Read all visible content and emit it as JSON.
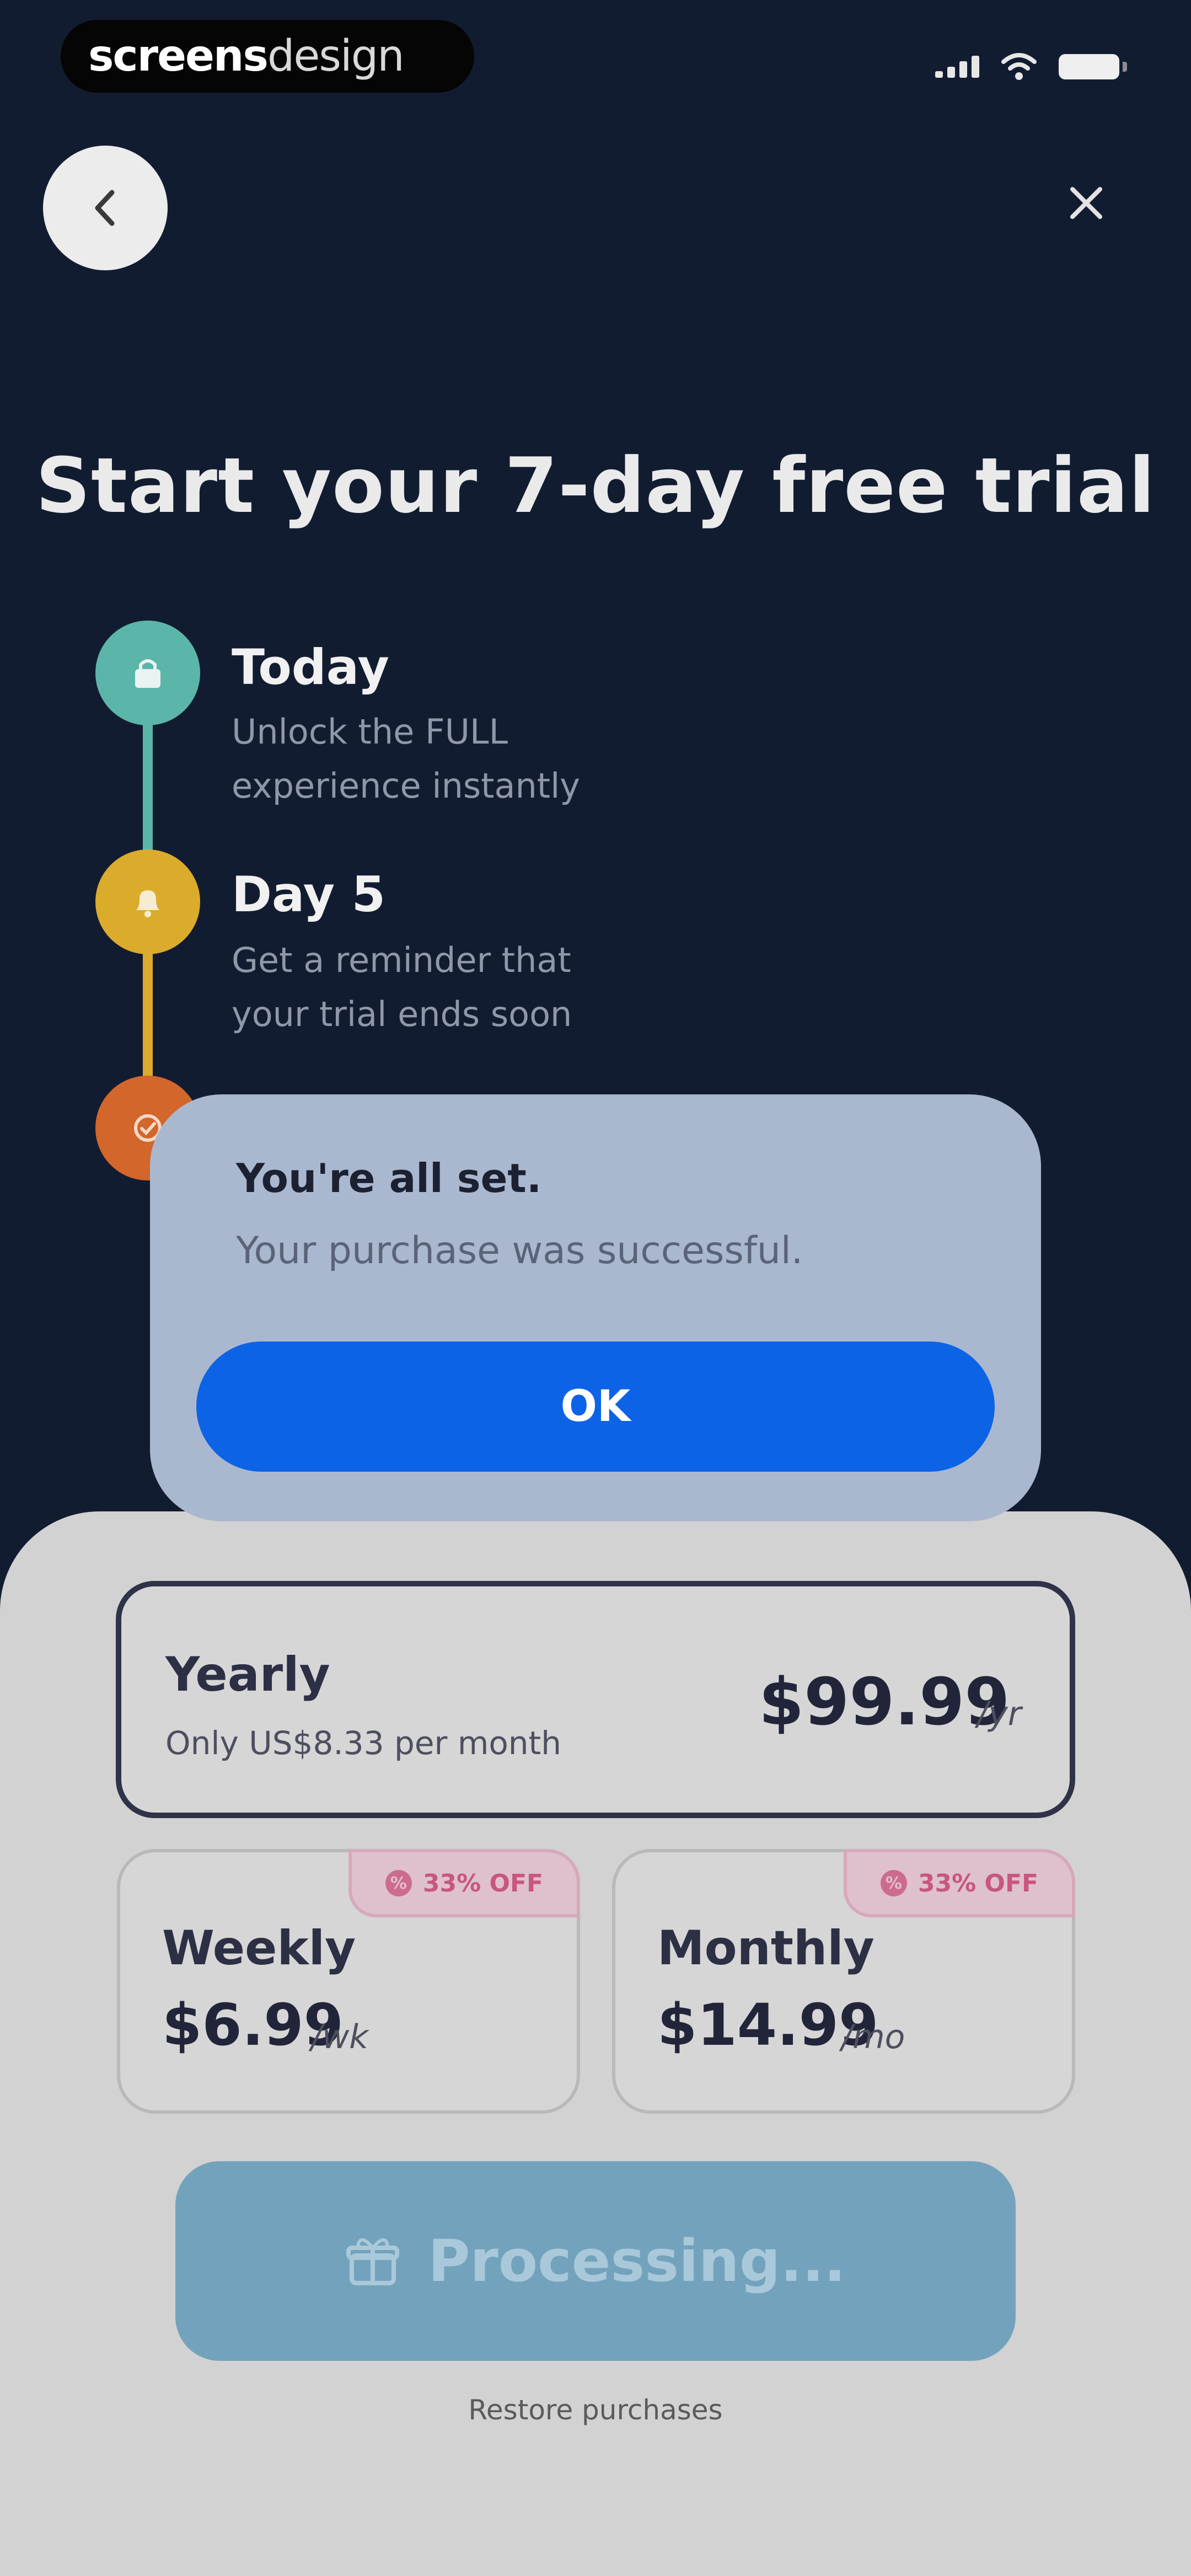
{
  "status_bar": {
    "logo_part1": "screens",
    "logo_part2": "design"
  },
  "header": {
    "back_icon": "chevron-left-icon",
    "close_icon": "close-icon"
  },
  "title": "Start your 7-day free trial",
  "timeline": [
    {
      "title": "Today",
      "desc_line1": "Unlock the FULL",
      "desc_line2": "experience instantly",
      "color": "#5bb5a8",
      "icon": "lock-icon"
    },
    {
      "title": "Day 5",
      "desc_line1": "Get a reminder that",
      "desc_line2": "your trial ends soon",
      "color": "#dbab2b",
      "icon": "bell-icon"
    },
    {
      "title": "",
      "desc_line1": "",
      "desc_line2": "",
      "color": "#d3662a",
      "icon": "badge-icon"
    }
  ],
  "plans": {
    "yearly": {
      "name": "Yearly",
      "subtitle": "Only US$8.33 per month",
      "price": "$99.99",
      "unit": "/yr"
    },
    "weekly": {
      "name": "Weekly",
      "price": "$6.99",
      "unit": "/wk",
      "badge": "33% OFF"
    },
    "monthly": {
      "name": "Monthly",
      "price": "$14.99",
      "unit": "/mo",
      "badge": "33% OFF"
    }
  },
  "cta": {
    "label": "Processing...",
    "icon": "gift-icon"
  },
  "restore": "Restore purchases",
  "alert": {
    "title": "You're all set.",
    "message": "Your purchase was successful.",
    "ok_label": "OK"
  },
  "colors": {
    "background": "#121c31",
    "sheet": "#d2d2d2",
    "alert_button": "#0d63e6",
    "cta": "#73a3bc",
    "badge_text": "#c8567f"
  }
}
